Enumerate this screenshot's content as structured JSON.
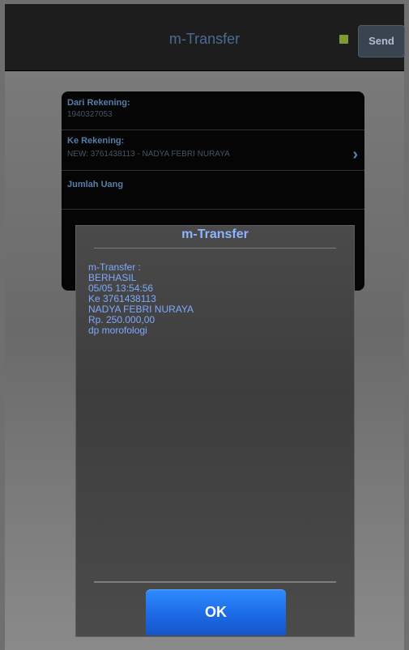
{
  "app_bar": {
    "title": "m-Transfer",
    "send_label": "Send"
  },
  "form": {
    "from_account_label": "Dari Rekening:",
    "from_account_value": "1940327053",
    "to_account_label": "Ke Rekening:",
    "to_account_value": "NEW: 3761438113 - NADYA FEBRI NURAYA",
    "amount_label": "Jumlah Uang"
  },
  "dialog": {
    "title": "m-Transfer",
    "lines": [
      "m-Transfer :",
      "BERHASIL",
      "05/05 13:54:56",
      "Ke 3761438113",
      "NADYA FEBRI NURAYA",
      "Rp. 250.000,00",
      "dp morofologi"
    ],
    "ok_label": "OK"
  }
}
